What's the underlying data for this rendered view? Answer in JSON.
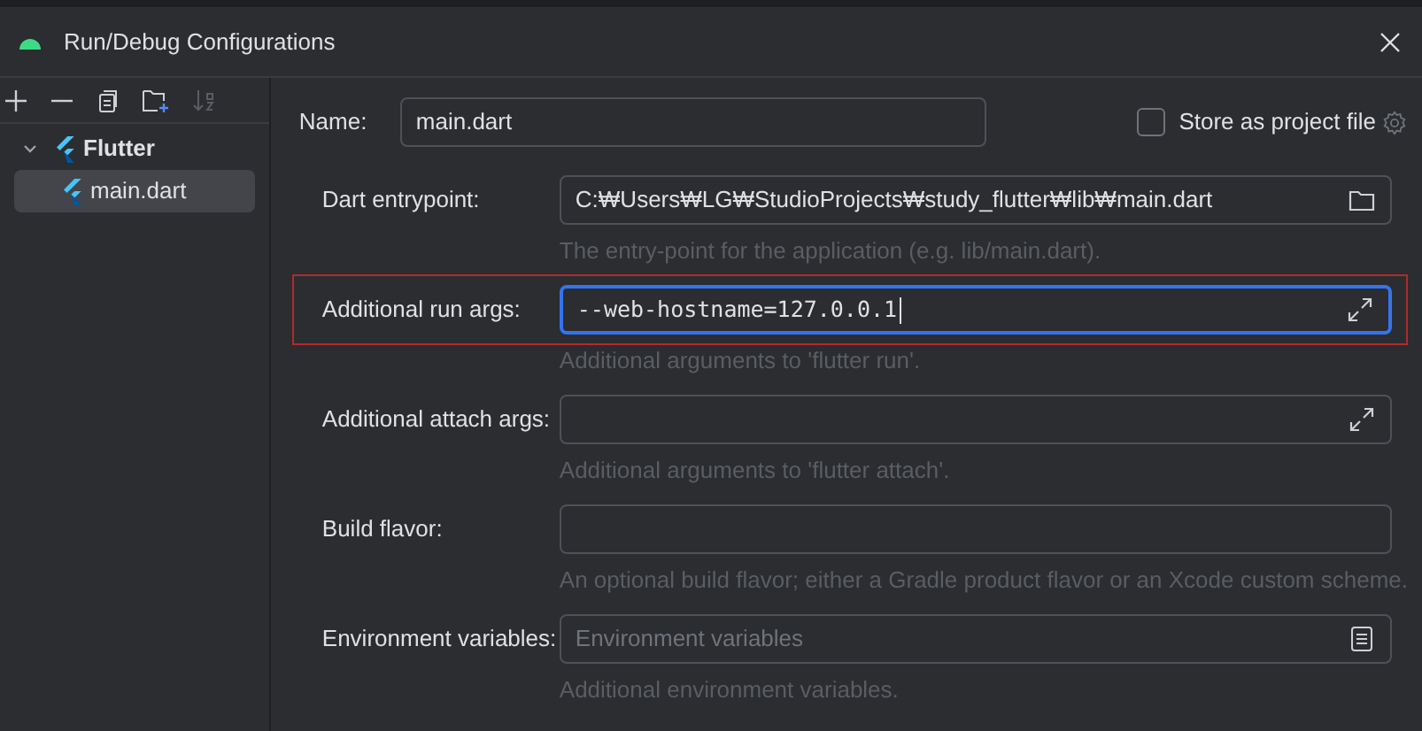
{
  "window": {
    "title": "Run/Debug Configurations"
  },
  "tree": [
    {
      "label": "Flutter",
      "expanded": true,
      "selected": false,
      "children": [
        {
          "label": "main.dart",
          "selected": true
        }
      ]
    }
  ],
  "name_field": {
    "label": "Name:",
    "value": "main.dart"
  },
  "store_as_project_file": {
    "label": "Store as project file",
    "checked": false
  },
  "fields": [
    {
      "kind": "browse",
      "label": "Dart entrypoint:",
      "value": "C:₩Users₩LG₩StudioProjects₩study_flutter₩lib₩main.dart",
      "hint": "The entry-point for the application (e.g. lib/main.dart).",
      "focused": false,
      "highlighted": false
    },
    {
      "kind": "expand",
      "label": "Additional run args:",
      "value": "--web-hostname=127.0.0.1",
      "hint": "Additional arguments to 'flutter run'.",
      "focused": true,
      "highlighted": true
    },
    {
      "kind": "expand",
      "label": "Additional attach args:",
      "hint": "Additional arguments to 'flutter attach'.",
      "focused": false,
      "highlighted": false
    },
    {
      "kind": "plain",
      "label": "Build flavor:",
      "hint": "An optional build flavor; either a Gradle product flavor or an Xcode custom scheme.",
      "focused": false,
      "highlighted": false
    },
    {
      "kind": "list",
      "label": "Environment variables:",
      "placeholder": "Environment variables",
      "hint": "Additional environment variables.",
      "focused": false,
      "highlighted": false
    }
  ]
}
